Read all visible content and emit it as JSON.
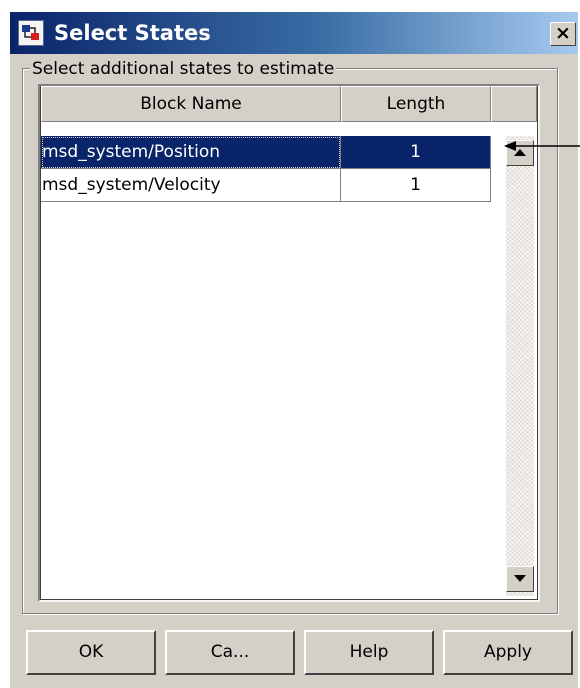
{
  "window": {
    "title": "Select States",
    "close_glyph": "×"
  },
  "group": {
    "label": "Select additional states to estimate"
  },
  "table": {
    "columns": [
      "Block Name",
      "Length"
    ],
    "rows": [
      {
        "block_name": "msd_system/Position",
        "length": "1",
        "selected": true
      },
      {
        "block_name": "msd_system/Velocity",
        "length": "1",
        "selected": false
      }
    ]
  },
  "buttons": {
    "ok": "OK",
    "cancel": "Ca...",
    "help": "Help",
    "apply": "Apply"
  },
  "icons": {
    "app": "simulink-app-icon",
    "close": "close-icon",
    "scroll_up": "scroll-up-arrow-icon",
    "scroll_down": "scroll-down-arrow-icon",
    "callout": "callout-arrow"
  },
  "colors": {
    "selection": "#0a246a",
    "title_gradient_start": "#0a246a",
    "title_gradient_end": "#a6caf0",
    "dialog_face": "#d4d0c8"
  }
}
